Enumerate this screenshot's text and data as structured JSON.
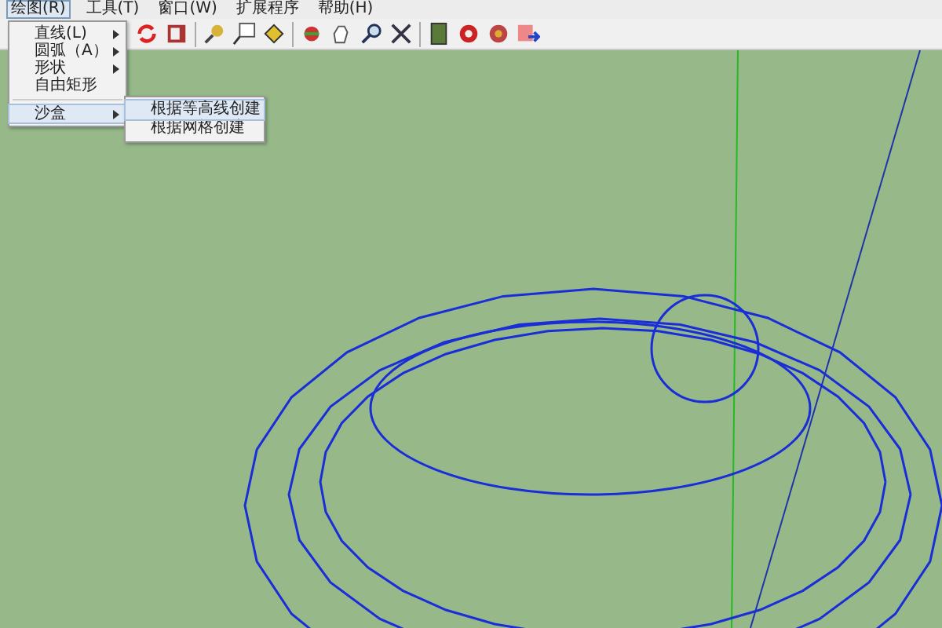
{
  "menu_bar": [
    {
      "label": "绘图(R)",
      "selected": true
    },
    {
      "label": "工具(T)",
      "selected": false
    },
    {
      "label": "窗口(W)",
      "selected": false
    },
    {
      "label": "扩展程序",
      "selected": false
    },
    {
      "label": "帮助(H)",
      "selected": false
    }
  ],
  "draw_menu": {
    "items": [
      {
        "label": "直线(L)",
        "has_submenu": true,
        "separator_before": false,
        "selected": false
      },
      {
        "label": "圆弧（A）",
        "has_submenu": true,
        "separator_before": false,
        "selected": false
      },
      {
        "label": "形状",
        "has_submenu": true,
        "separator_before": false,
        "selected": false
      },
      {
        "label": "自由矩形",
        "has_submenu": false,
        "separator_before": false,
        "selected": false
      },
      {
        "label": "沙盒",
        "has_submenu": true,
        "separator_before": true,
        "selected": true
      }
    ]
  },
  "sandbox_submenu": {
    "items": [
      {
        "label": "根据等高线创建",
        "selected": true
      },
      {
        "label": "根据网格创建",
        "selected": false
      }
    ]
  }
}
